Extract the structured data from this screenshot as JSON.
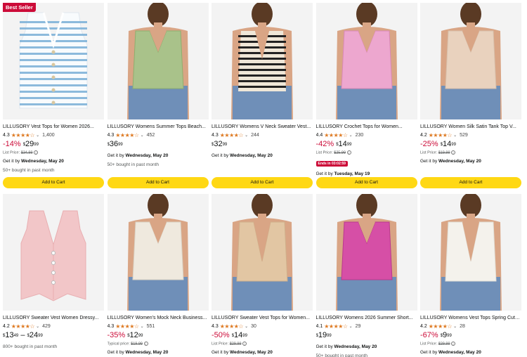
{
  "products": [
    {
      "badge": "Best Seller",
      "title": "LILLUSORY Vest Tops for Women 2026...",
      "rating": "4.3",
      "stars": "★★★★☆",
      "reviews": "1,400",
      "discount": "-14%",
      "price_dollars": "29",
      "price_cents": "99",
      "list_label": "List Price:",
      "list_price": "$34.99",
      "deal": "",
      "delivery_prefix": "Get it by ",
      "delivery_date": "Wednesday, May 20",
      "bought": "50+ bought in past month",
      "cart": "Add to Cart"
    },
    {
      "badge": "",
      "title": "LILLUSORY Womens Summer Tops Beach...",
      "rating": "4.3",
      "stars": "★★★★☆",
      "reviews": "452",
      "discount": "",
      "price_dollars": "36",
      "price_cents": "99",
      "list_label": "",
      "list_price": "",
      "deal": "",
      "delivery_prefix": "Get it by ",
      "delivery_date": "Wednesday, May 20",
      "bought": "50+ bought in past month",
      "cart": "Add to Cart"
    },
    {
      "badge": "",
      "title": "LILLUSORY Womens V Neck Sweater Vest...",
      "rating": "4.3",
      "stars": "★★★★☆",
      "reviews": "244",
      "discount": "",
      "price_dollars": "32",
      "price_cents": "99",
      "list_label": "",
      "list_price": "",
      "deal": "",
      "delivery_prefix": "Get it by ",
      "delivery_date": "Wednesday, May 20",
      "bought": "",
      "cart": "Add to Cart"
    },
    {
      "badge": "",
      "title": "LILLUSORY Crochet Tops for Women...",
      "rating": "4.4",
      "stars": "★★★★☆",
      "reviews": "230",
      "discount": "-42%",
      "price_dollars": "14",
      "price_cents": "99",
      "list_label": "List Price:",
      "list_price": "$25.99",
      "deal": "Ends in 03:02:59",
      "delivery_prefix": "Get it by ",
      "delivery_date": "Tuesday, May 19",
      "bought": "",
      "cart": "Add to Cart"
    },
    {
      "badge": "",
      "title": "LILLUSORY Women Silk Satin Tank Top V...",
      "rating": "4.2",
      "stars": "★★★★☆",
      "reviews": "529",
      "discount": "-25%",
      "price_dollars": "14",
      "price_cents": "99",
      "list_label": "List Price:",
      "list_price": "$19.99",
      "deal": "",
      "delivery_prefix": "Get it by ",
      "delivery_date": "Wednesday, May 20",
      "bought": "",
      "cart": "Add to Cart"
    },
    {
      "badge": "",
      "title": "LILLUSORY Sweater Vest Women Dressy...",
      "rating": "4.2",
      "stars": "★★★★☆",
      "reviews": "429",
      "discount": "",
      "price_range": true,
      "price_dollars": "13",
      "price_cents": "49",
      "price_dollars2": "24",
      "price_cents2": "99",
      "list_label": "",
      "list_price": "",
      "deal": "",
      "delivery_prefix": "",
      "delivery_date": "",
      "bought": "800+ bought in past month",
      "cart": ""
    },
    {
      "badge": "",
      "title": "LILLUSORY Women's Mock Neck Business...",
      "rating": "4.3",
      "stars": "★★★★☆",
      "reviews": "551",
      "discount": "-35%",
      "price_dollars": "12",
      "price_cents": "99",
      "list_label": "Typical price:",
      "list_price": "$19.99",
      "deal": "",
      "delivery_prefix": "Get it by ",
      "delivery_date": "Wednesday, May 20",
      "bought": "",
      "cart": ""
    },
    {
      "badge": "",
      "title": "LILLUSORY Sweater Vest Tops for Women...",
      "rating": "4.3",
      "stars": "★★★★☆",
      "reviews": "30",
      "discount": "-50%",
      "price_dollars": "14",
      "price_cents": "99",
      "list_label": "List Price:",
      "list_price": "$29.99",
      "deal": "",
      "delivery_prefix": "Get it by ",
      "delivery_date": "Wednesday, May 20",
      "bought": "",
      "cart": ""
    },
    {
      "badge": "",
      "title": "LILLUSORY Womens 2026 Summer Short...",
      "rating": "4.1",
      "stars": "★★★★☆",
      "reviews": "29",
      "discount": "",
      "price_dollars": "19",
      "price_cents": "99",
      "list_label": "",
      "list_price": "",
      "deal": "",
      "delivery_prefix": "Get it by ",
      "delivery_date": "Wednesday, May 20",
      "bought": "50+ bought in past month",
      "cart": ""
    },
    {
      "badge": "",
      "title": "LILLUSORY Womens Vest Tops Spring Cute...",
      "rating": "4.2",
      "stars": "★★★★☆",
      "reviews": "28",
      "discount": "-67%",
      "price_dollars": "9",
      "price_cents": "99",
      "list_label": "List Price:",
      "list_price": "$29.99",
      "deal": "",
      "delivery_prefix": "Get it by ",
      "delivery_date": "Wednesday, May 20",
      "bought": "",
      "cart": ""
    }
  ],
  "colors": {
    "star": "#de7921",
    "discount": "#cc0c39",
    "cart_button": "#ffd814",
    "image_bg": "#f3f3f3"
  },
  "images": [
    {
      "kind": "striped-vest",
      "garment": "#f8fbfd",
      "accent": "#7fb2d8",
      "skin": false
    },
    {
      "kind": "model-top",
      "garment": "#a9c28a",
      "accent": "#8fae6e",
      "skin": true
    },
    {
      "kind": "model-vest-striped",
      "garment": "#efe7d8",
      "accent": "#222222",
      "skin": true
    },
    {
      "kind": "model-top",
      "garment": "#eda7cf",
      "accent": "#d988b6",
      "skin": true
    },
    {
      "kind": "model-top",
      "garment": "#e9d2be",
      "accent": "#d8bfaa",
      "skin": true
    },
    {
      "kind": "flat-vest",
      "garment": "#f2c6c8",
      "accent": "#e8aeb1",
      "skin": false
    },
    {
      "kind": "model-top",
      "garment": "#efe9de",
      "accent": "#d9d1c3",
      "skin": true
    },
    {
      "kind": "model-vest",
      "garment": "#e2c6a3",
      "accent": "#cfb08b",
      "skin": true
    },
    {
      "kind": "model-top",
      "garment": "#d64fa6",
      "accent": "#b93a8c",
      "skin": true
    },
    {
      "kind": "model-vest",
      "garment": "#f4f2ec",
      "accent": "#e1ded5",
      "skin": true
    }
  ]
}
